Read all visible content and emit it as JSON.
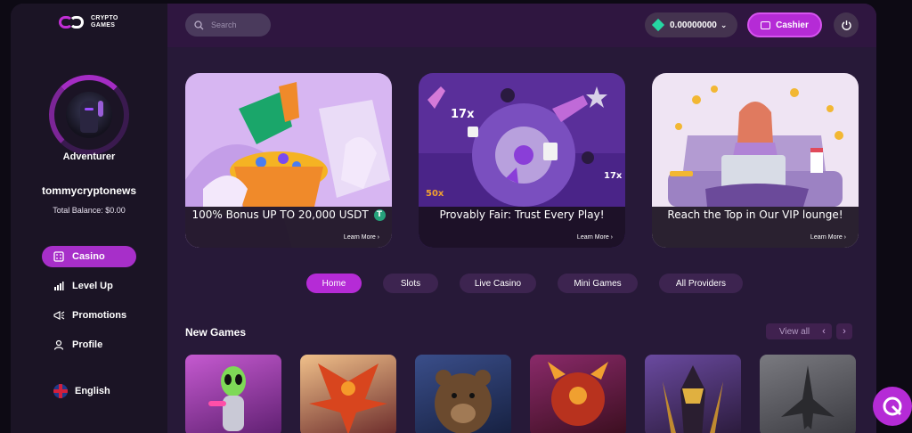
{
  "brand": {
    "line1": "CRYPTO",
    "line2": "GAMES"
  },
  "profile": {
    "level": "Adventurer",
    "username": "tommycryptonews",
    "balance_text": "Total Balance: $0.00"
  },
  "nav": {
    "items": [
      {
        "label": "Casino",
        "icon": "casino-icon",
        "active": true
      },
      {
        "label": "Level Up",
        "icon": "bar-chart-icon",
        "active": false
      },
      {
        "label": "Promotions",
        "icon": "megaphone-icon",
        "active": false
      },
      {
        "label": "Profile",
        "icon": "user-icon",
        "active": false
      }
    ],
    "language": "English"
  },
  "topbar": {
    "search_placeholder": "Search",
    "wallet_amount": "0.00000000",
    "cashier_label": "Cashier"
  },
  "banners": [
    {
      "headline": "100% Bonus UP TO 20,000 USDT",
      "cta": "Learn More ›",
      "badge": "T"
    },
    {
      "headline": "Provably Fair: Trust Every Play!",
      "cta": "Learn More ›",
      "labels": [
        "17x",
        "17x",
        "50x"
      ]
    },
    {
      "headline": "Reach the Top in Our VIP lounge!",
      "cta": "Learn More ›"
    }
  ],
  "tabs": [
    {
      "label": "Home",
      "active": true
    },
    {
      "label": "Slots",
      "active": false
    },
    {
      "label": "Live Casino",
      "active": false
    },
    {
      "label": "Mini Games",
      "active": false
    },
    {
      "label": "All Providers",
      "active": false
    }
  ],
  "new_games": {
    "title": "New Games",
    "view_all": "View all",
    "prev": "‹",
    "next": "›",
    "games": [
      "alien-game",
      "phoenix-game",
      "bear-game",
      "demon-game",
      "pharaoh-game",
      "jet-game"
    ]
  },
  "colors": {
    "accent": "#b52bd6",
    "sidebar": "#1b1425",
    "main": "#271938",
    "topbar": "#2f1640"
  }
}
